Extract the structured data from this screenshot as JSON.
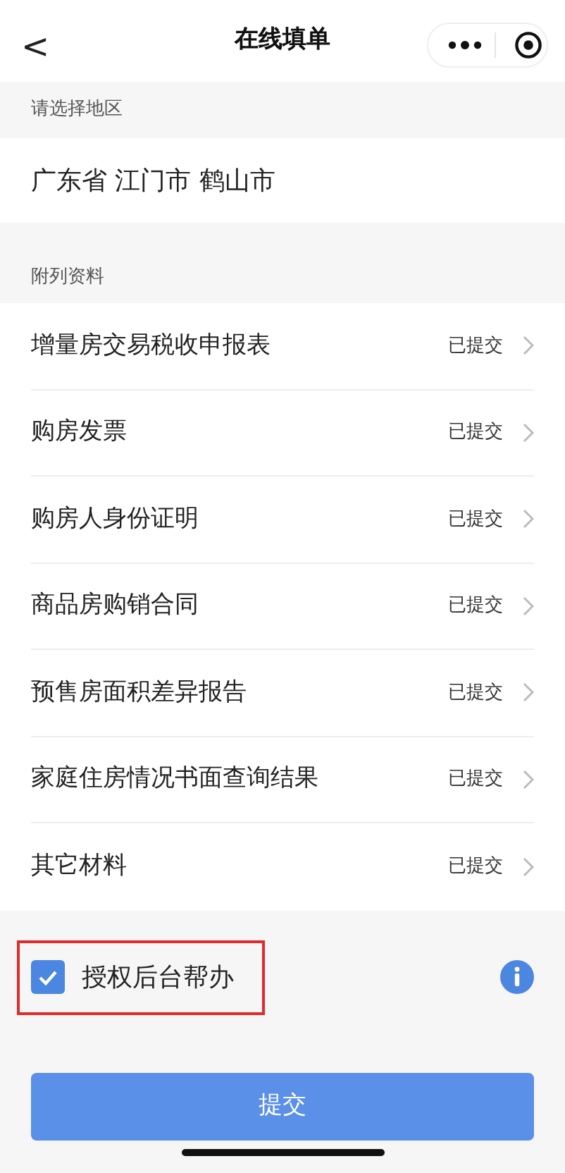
{
  "nav": {
    "back": "<",
    "title": "在线填单"
  },
  "region": {
    "label": "请选择地区",
    "value": "广东省 江门市 鹤山市"
  },
  "attachments": {
    "label": "附列资料",
    "items": [
      {
        "name": "增量房交易税收申报表",
        "status": "已提交"
      },
      {
        "name": "购房发票",
        "status": "已提交"
      },
      {
        "name": "购房人身份证明",
        "status": "已提交"
      },
      {
        "name": "商品房购销合同",
        "status": "已提交"
      },
      {
        "name": "预售房面积差异报告",
        "status": "已提交"
      },
      {
        "name": "家庭住房情况书面查询结果",
        "status": "已提交"
      },
      {
        "name": "其它材料",
        "status": "已提交"
      }
    ]
  },
  "authorize": {
    "label": "授权后台帮办",
    "checked": true,
    "highlighted": true
  },
  "submit": "提交"
}
